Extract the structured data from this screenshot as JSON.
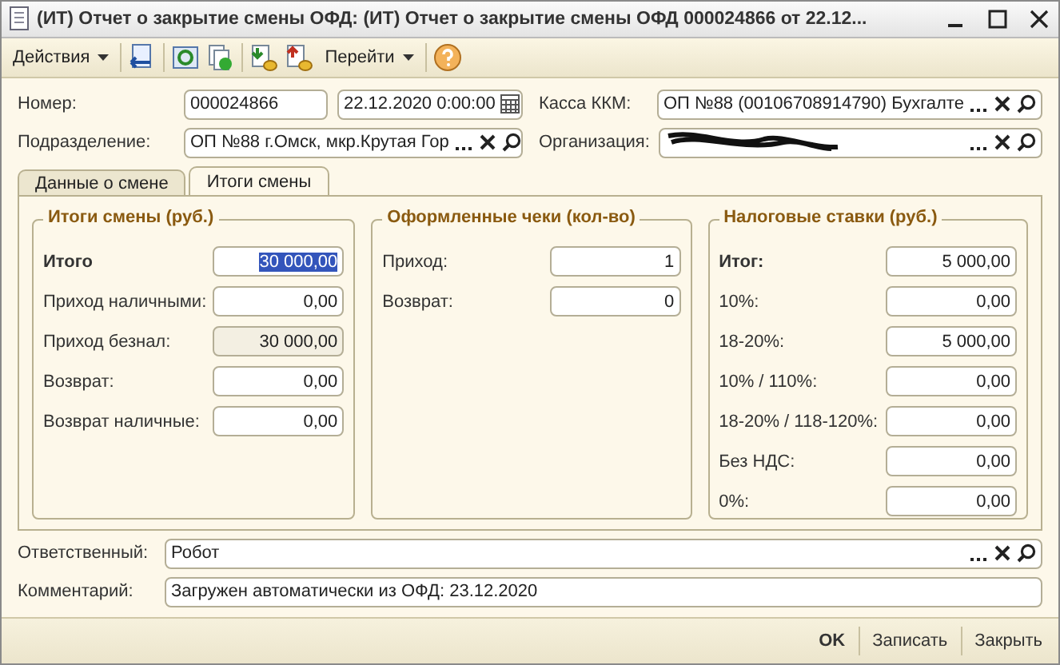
{
  "window": {
    "title": "(ИТ) Отчет о закрытие смены ОФД: (ИТ) Отчет о закрытие смены ОФД 000024866 от 22.12..."
  },
  "toolbar": {
    "actions_menu": "Действия",
    "goto_menu": "Перейти"
  },
  "header": {
    "number_label": "Номер:",
    "number": "000024866",
    "date": "22.12.2020  0:00:00",
    "register_label": "Касса ККМ:",
    "register": "ОП №88 (00106708914790) Бухгалте",
    "division_label": "Подразделение:",
    "division": "ОП №88 г.Омск, мкр.Крутая Гор",
    "organization_label": "Организация:"
  },
  "tabs": [
    {
      "label": "Данные о смене",
      "selected": false
    },
    {
      "label": "Итоги смены",
      "selected": true
    }
  ],
  "groups": [
    {
      "title": "Итоги смены (руб.)",
      "rows": [
        {
          "label": "Итого",
          "value": "30 000,00",
          "bold": true,
          "readonly": false,
          "highlighted": true
        },
        {
          "label": "Приход наличными:",
          "value": "0,00",
          "bold": false,
          "readonly": false,
          "highlighted": false
        },
        {
          "label": "Приход безнал:",
          "value": "30 000,00",
          "bold": false,
          "readonly": true,
          "highlighted": false
        },
        {
          "label": "Возврат:",
          "value": "0,00",
          "bold": false,
          "readonly": false,
          "highlighted": false
        },
        {
          "label": "Возврат наличные:",
          "value": "0,00",
          "bold": false,
          "readonly": false,
          "highlighted": false
        }
      ]
    },
    {
      "title": "Оформленные чеки (кол-во)",
      "rows": [
        {
          "label": "Приход:",
          "value": "1",
          "bold": false,
          "readonly": false,
          "highlighted": false
        },
        {
          "label": "Возврат:",
          "value": "0",
          "bold": false,
          "readonly": false,
          "highlighted": false
        }
      ]
    },
    {
      "title": "Налоговые ставки (руб.)",
      "rows": [
        {
          "label": "Итог:",
          "value": "5 000,00",
          "bold": true,
          "readonly": false,
          "highlighted": false
        },
        {
          "label": "10%:",
          "value": "0,00",
          "bold": false,
          "readonly": false,
          "highlighted": false
        },
        {
          "label": "18-20%:",
          "value": "5 000,00",
          "bold": false,
          "readonly": false,
          "highlighted": false
        },
        {
          "label": "10% / 110%:",
          "value": "0,00",
          "bold": false,
          "readonly": false,
          "highlighted": false
        },
        {
          "label": "18-20% / 118-120%:",
          "value": "0,00",
          "bold": false,
          "readonly": false,
          "highlighted": false
        },
        {
          "label": "Без НДС:",
          "value": "0,00",
          "bold": false,
          "readonly": false,
          "highlighted": false
        },
        {
          "label": "0%:",
          "value": "0,00",
          "bold": false,
          "readonly": false,
          "highlighted": false
        }
      ]
    }
  ],
  "footer": {
    "responsible_label": "Ответственный:",
    "responsible": "Робот",
    "comment_label": "Комментарий:",
    "comment": "Загружен автоматически из ОФД: 23.12.2020"
  },
  "buttons": [
    {
      "label": "OK",
      "default": true
    },
    {
      "label": "Записать",
      "default": false
    },
    {
      "label": "Закрыть",
      "default": false
    }
  ]
}
